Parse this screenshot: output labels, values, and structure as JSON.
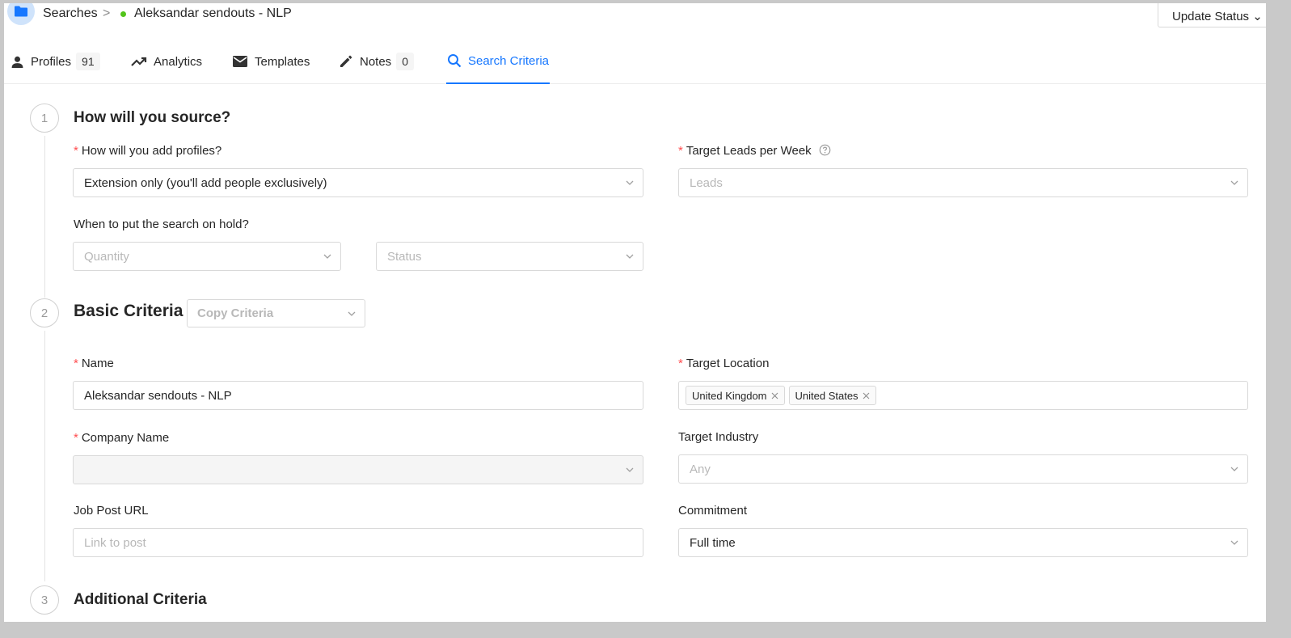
{
  "breadcrumb": {
    "root": "Searches",
    "separator": ">",
    "current": "Aleksandar sendouts - NLP"
  },
  "header": {
    "update_status_label": "Update Status"
  },
  "tabs": [
    {
      "label": "Profiles",
      "count": "91",
      "icon": "person-icon"
    },
    {
      "label": "Analytics",
      "icon": "trend-icon"
    },
    {
      "label": "Templates",
      "icon": "mail-icon"
    },
    {
      "label": "Notes",
      "count": "0",
      "icon": "pencil-icon"
    },
    {
      "label": "Search Criteria",
      "icon": "search-icon",
      "active": true
    }
  ],
  "steps": [
    {
      "number": "1",
      "title": "How will you source?"
    },
    {
      "number": "2",
      "title": "Basic Criteria"
    },
    {
      "number": "3",
      "title": "Additional Criteria"
    }
  ],
  "sourcing": {
    "add_profiles_label": "How will you add profiles?",
    "add_profiles_value": "Extension only (you'll add people exclusively)",
    "target_leads_label": "Target Leads per Week",
    "target_leads_placeholder": "Leads",
    "hold_label": "When to put the search on hold?",
    "quantity_placeholder": "Quantity",
    "status_placeholder": "Status"
  },
  "basic": {
    "copy_criteria_placeholder": "Copy Criteria",
    "name_label": "Name",
    "name_value": "Aleksandar sendouts - NLP",
    "target_location_label": "Target Location",
    "target_location_tags": [
      "United Kingdom",
      "United States"
    ],
    "company_name_label": "Company Name",
    "target_industry_label": "Target Industry",
    "target_industry_placeholder": "Any",
    "job_post_url_label": "Job Post URL",
    "job_post_url_placeholder": "Link to post",
    "commitment_label": "Commitment",
    "commitment_value": "Full time"
  },
  "colors": {
    "accent": "#1677ff",
    "required": "#ff4d4f",
    "status_dot": "#52c41a"
  }
}
